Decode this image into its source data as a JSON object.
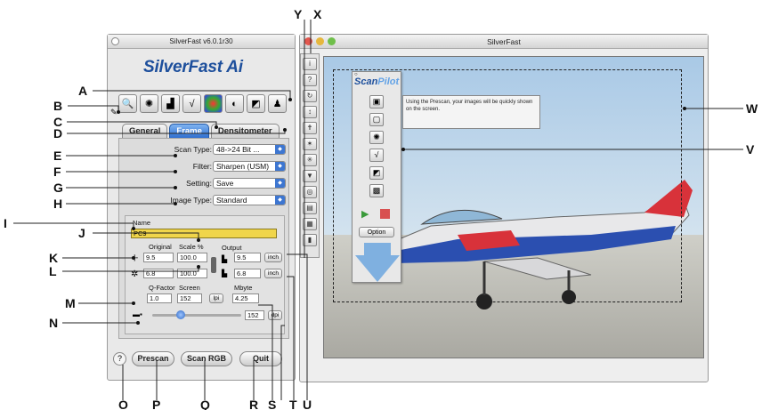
{
  "left_window": {
    "title": "SilverFast v6.0.1r30",
    "logo": "SilverFast Ai",
    "tabs": [
      "General",
      "Frame",
      "Densitometer"
    ],
    "scan_type_label": "Scan Type:",
    "scan_type_value": "48->24 Bit ...",
    "filter_label": "Filter:",
    "filter_value": "Sharpen (USM)",
    "setting_label": "Setting:",
    "setting_value": "Save",
    "image_type_label": "Image Type:",
    "image_type_value": "Standard",
    "name_label": "Name",
    "name_value": "PC9",
    "original_label": "Original",
    "scale_label": "Scale %",
    "output_label": "Output",
    "orig_w": "9.5",
    "orig_h": "6.8",
    "scale_1": "100.0",
    "scale_2": "100.0",
    "out_w": "9.5",
    "out_h": "6.8",
    "unit_1": "inch",
    "unit_2": "inch",
    "qfactor_label": "Q-Factor",
    "screen_label": "Screen",
    "mbyte_label": "Mbyte",
    "qfactor_value": "1.0",
    "screen_value": "152",
    "lpi_label": "lpi",
    "mbyte_value": "4.25",
    "resolution_value": "152",
    "dpi_label": "dpi",
    "resolution_slider_fraction": 0.3,
    "buttons": [
      "Prescan",
      "Scan RGB",
      "Quit"
    ]
  },
  "right_window": {
    "title": "SilverFast",
    "scanpilot_title_a": "Scan",
    "scanpilot_title_b": "Pilot",
    "scanpilot_info": "Using the Prescan, your images will be quickly shown on the screen.",
    "option_button": "Option"
  },
  "callouts": {
    "A": "A",
    "B": "B",
    "C": "C",
    "D": "D",
    "E": "E",
    "F": "F",
    "G": "G",
    "H": "H",
    "I": "I",
    "J": "J",
    "K": "K",
    "L": "L",
    "M": "M",
    "N": "N",
    "O": "O",
    "P": "P",
    "Q": "Q",
    "R": "R",
    "S": "S",
    "T": "T",
    "U": "U",
    "V": "V",
    "W": "W",
    "X": "X",
    "Y": "Y"
  },
  "colors": {
    "accent": "#2f6fd0",
    "name_field": "#f0d54a",
    "brand": "#1d4f9c"
  }
}
